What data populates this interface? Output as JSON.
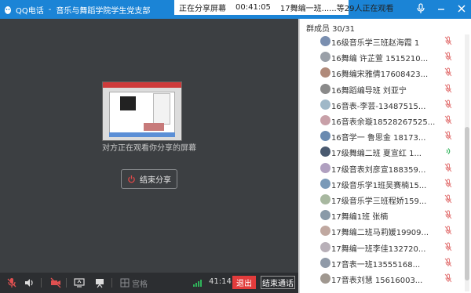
{
  "titlebar": {
    "app_name": "QQ电话",
    "separator": "-",
    "group_name": "音乐与舞蹈学院学生党支部",
    "status_label": "正在分享屏幕",
    "timer": "00:41:05",
    "viewers": "17舞编一班......等29人正在观看",
    "controls": [
      "mic-icon",
      "minimize-icon",
      "close-icon"
    ]
  },
  "main": {
    "share_message": "对方正在观看你分享的屏幕",
    "end_share_label": "结束分享"
  },
  "toolbar": {
    "grid_label": "宫格",
    "duration": "41:14",
    "exit_label": "退出",
    "end_call_label": "结束通话"
  },
  "panel": {
    "header": "群成员 30/31",
    "members": [
      {
        "name": "16级音乐学三班赵海霞 1",
        "avatar_color": "#7a8fb0",
        "mic": "muted"
      },
      {
        "name": "16舞编 许芷萱 1515210...",
        "avatar_color": "#9aa0a8",
        "mic": "muted"
      },
      {
        "name": "16舞编宋雅倩17608423...",
        "avatar_color": "#b08a7a",
        "mic": "muted"
      },
      {
        "name": "16舞蹈编导班 刘亚宁",
        "avatar_color": "#8a8a8a",
        "mic": "muted"
      },
      {
        "name": "16音表-李芸-13487515...",
        "avatar_color": "#a0b8c8",
        "mic": "muted"
      },
      {
        "name": "16音表余璇18528267525...",
        "avatar_color": "#c8a0a8",
        "mic": "muted"
      },
      {
        "name": "16音学一 鲁思金 18173...",
        "avatar_color": "#6a8ab0",
        "mic": "muted"
      },
      {
        "name": "17级舞编二班  夏宣红  1...",
        "avatar_color": "#4a5a70",
        "mic": "speaking"
      },
      {
        "name": "17级音表刘彦宣188359...",
        "avatar_color": "#b0a0c0",
        "mic": "muted"
      },
      {
        "name": "17级音乐学1班吴赛楠15...",
        "avatar_color": "#7a9ab8",
        "mic": "muted"
      },
      {
        "name": "17级音乐学三班程娇159...",
        "avatar_color": "#a8b8a0",
        "mic": "muted"
      },
      {
        "name": "17舞编1班 张楠",
        "avatar_color": "#8a9aa8",
        "mic": "muted"
      },
      {
        "name": "17舞编二班马莉媛19909...",
        "avatar_color": "#c0a8a0",
        "mic": "muted"
      },
      {
        "name": "17舞编一班李佳132720...",
        "avatar_color": "#b8b0b8",
        "mic": "muted"
      },
      {
        "name": "17音表一班13555168...",
        "avatar_color": "#909aa8",
        "mic": "muted"
      },
      {
        "name": "17音表刘慧 15616003...",
        "avatar_color": "#a09890",
        "mic": "muted"
      }
    ]
  },
  "colors": {
    "titlebar": "#1b84d6",
    "exit_button": "#e23c3c",
    "muted_mic": "#e06a6a",
    "speaking_mic": "#2fb35a"
  }
}
